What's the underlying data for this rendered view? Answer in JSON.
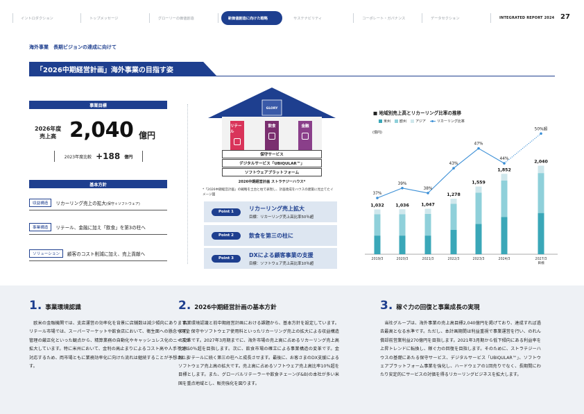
{
  "nav": {
    "tabs": [
      "イントロダクション",
      "トップメッセージ",
      "グローリーの価値創造",
      "新価値創造に向けた戦略",
      "サステナビリティ",
      "コーポレート・ガバナンス",
      "データセクション"
    ],
    "active_index": 3,
    "report_label": "INTEGRATED REPORT 2024",
    "page_number": "27"
  },
  "breadcrumb": "海外事業　長期ビジョンの達成に向けて",
  "title": "「2026中期経営計画」海外事業の目指す姿",
  "goal": {
    "header": "事業目標",
    "label_line1": "2026年度",
    "label_line2": "売上高",
    "value": "2,040",
    "unit": "億円",
    "compare_label": "2023年度比較",
    "compare_value": "+188",
    "compare_unit": "億円"
  },
  "policy": {
    "header": "基本方針",
    "rows": [
      {
        "tag": "収益構造",
        "text": "リカーリング売上の拡大",
        "sub": "(保守＋ソフトウェア)"
      },
      {
        "tag": "事業構造",
        "text": "リテール、金融に加え「飲食」を第3の柱へ",
        "sub": ""
      },
      {
        "tag": "ソリューション",
        "text": "顧客のコスト削減に加え、売上貢献へ",
        "sub": ""
      }
    ]
  },
  "house": {
    "logo": "GLORY",
    "pillars": [
      "リテール",
      "飲食",
      "金融"
    ],
    "layers": [
      "保守サービス",
      "デジタルサービス「UBIQULAR™」",
      "ソフトウェアプラットフォーム"
    ],
    "caption": "2026中期経営計画 ストラテジーハウス*",
    "note": "*「2026中期経営計画」の戦略を土台と柱で表現し、計画達成をハウスの建築に見立てたイメージ図",
    "colors": {
      "roof": "#1e3f8f",
      "retail": "#d9345a",
      "food": "#7a2f6f",
      "finance": "#8a3f8a"
    }
  },
  "points": [
    {
      "tag": "Point 1",
      "title": "リカーリング売上拡大",
      "sub": "目標：リカーリング売上高比率50％超"
    },
    {
      "tag": "Point 2",
      "title": "飲食を第三の柱に",
      "sub": ""
    },
    {
      "tag": "Point 3",
      "title": "DXによる顧客事業の支援",
      "sub": "目標：ソフトウェア売上高比率10％超"
    }
  ],
  "chart_data": {
    "type": "bar",
    "title": "地域別売上高とリカーリング比率の推移",
    "unit_label": "(億円)",
    "legend": [
      {
        "name": "米州",
        "color": "#3aa7b8"
      },
      {
        "name": "欧州",
        "color": "#8fd0da"
      },
      {
        "name": "アジア",
        "color": "#cfe7ec"
      },
      {
        "name": "リカーリング比率",
        "color": "#3b8fd6"
      }
    ],
    "categories": [
      "2019/3",
      "2020/3",
      "2021/3",
      "2022/3",
      "2023/3",
      "2024/3",
      "2027/3"
    ],
    "category_sub": [
      "",
      "",
      "",
      "",
      "",
      "",
      "目標"
    ],
    "totals": [
      1032,
      1036,
      1047,
      1278,
      1559,
      1852,
      2040
    ],
    "total_labels": [
      "1,032",
      "1,036",
      "1,047",
      "1,278",
      "1,559",
      "1,852",
      "2,040"
    ],
    "series": [
      {
        "name": "米州",
        "values": [
          430,
          430,
          430,
          560,
          700,
          860,
          950
        ]
      },
      {
        "name": "欧州",
        "values": [
          490,
          490,
          500,
          600,
          720,
          840,
          920
        ]
      },
      {
        "name": "アジア",
        "values": [
          112,
          116,
          117,
          118,
          139,
          152,
          170
        ]
      }
    ],
    "recurring_ratio": [
      37,
      39,
      38,
      43,
      47,
      44,
      50
    ],
    "recurring_labels": [
      "37%",
      "39%",
      "38%",
      "43%",
      "47%",
      "44%",
      "50%超"
    ],
    "ylim": [
      0,
      2400
    ]
  },
  "bottom": [
    {
      "num": "1.",
      "title": "事業環境認識",
      "body": "欧米の金融機関では、支店運営の効率化を背景に店舗数は減少傾向にあります。リテール市場では、スーパーマーケットや飲食店において、衛生面への懸念や現金管理の厳正化といった観点から、精算業務の自動化やキャッシュレス化のニーズが拡大しています。特に米州において、金利の高止まりによるコスト高や人手不足に対応するため、両市場ともに業務効率化に向けた流れは継続することが予想されます。"
    },
    {
      "num": "2.",
      "title": "2026中期経営計画の基本方針",
      "body": "事業環境認識と前中期経営計画における課題から、基本方針を設定しています。まず、保守やソフトウェア使用料といったリカーリング売上の拡大による収益構造の変革です。2027年3月期までに、海外市場の売上高に占めるリカーリング売上高比率50％超を目指します。次に、飲食市場の確立による事業構造の変革です。金融、リテールに続く第三の柱へと成長させます。最後に、お客さまのDX支援によるソフトウェア売上高の拡大です。売上高に占めるソフトウェア売上高比率10％超を目標とします。また、グローバルリテーラーや飲食チェーン(F&B)の本社が多い米国を重点地域とし、販売強化を図ります。"
    },
    {
      "num": "3.",
      "title": "稼ぐ力の回復と事業成長の実現",
      "body": "当社グループは、海外事業の売上高目標2,040億円を掲げており、達成すれば過去最高となる水準です。ただし、本計画期間は利益重視で事業運営を行い、のれん償却前営業利益270億円を目指します。2021年3月期から低下傾向にある利益率を上昇トレンドに転換し、稼ぐ力の回復を目指します。そのために、ストラテジーハウスの基礎にあたる保守サービス、デジタルサービス「UBIQULAR™」、ソフトウェアプラットフォーム事業を強化し、ハードウェアの1回売りでなく、長期間にわたり安定的にサービスの対価を得るリカーリングビジネスを拡大します。"
    }
  ]
}
